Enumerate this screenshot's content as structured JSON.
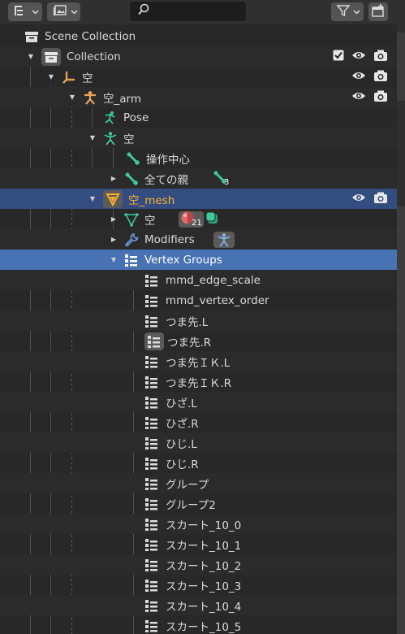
{
  "header": {
    "search_placeholder": ""
  },
  "colors": {
    "accent_orange": "#ffaf29",
    "bone_green": "#3fc79d",
    "selected_row": "#4772b3",
    "active_row": "#334d80"
  },
  "tree": {
    "scene_collection": "Scene Collection",
    "collection": "Collection",
    "obj_sora": "空",
    "arm": "空_arm",
    "pose": "Pose",
    "armature_data": "空",
    "bone_center": "操作中心",
    "bone_parent": "全ての親",
    "bone_count": "3",
    "mesh": "空_mesh",
    "mesh_data": "空",
    "material_count": "21",
    "modifiers": "Modifiers",
    "vertex_groups": "Vertex Groups",
    "groups": [
      "mmd_edge_scale",
      "mmd_vertex_order",
      "つま先.L",
      "つま先.R",
      "つま先ＩＫ.L",
      "つま先ＩＫ.R",
      "ひざ.L",
      "ひざ.R",
      "ひじ.L",
      "ひじ.R",
      "グループ",
      "グループ2",
      "スカート_10_0",
      "スカート_10_1",
      "スカート_10_2",
      "スカート_10_3",
      "スカート_10_4",
      "スカート_10_5"
    ]
  }
}
